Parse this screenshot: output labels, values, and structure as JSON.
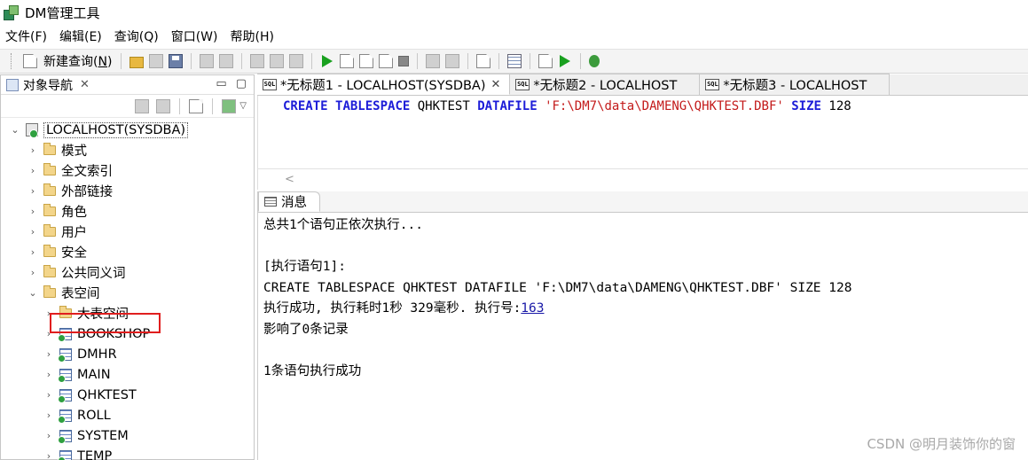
{
  "window": {
    "title": "DM管理工具"
  },
  "menu": [
    "文件(F)",
    "编辑(E)",
    "查询(Q)",
    "窗口(W)",
    "帮助(H)"
  ],
  "toolbar": {
    "new_query_prefix": "新建查询(",
    "new_query_key": "N",
    "new_query_suffix": ")"
  },
  "navigator": {
    "tab_label": "对象导航",
    "close": "✕",
    "minimize": "▭",
    "maximize": "▢",
    "root": "LOCALHOST(SYSDBA)",
    "items": [
      "模式",
      "全文索引",
      "外部链接",
      "角色",
      "用户",
      "安全",
      "公共同义词",
      "表空间"
    ],
    "tablespace_children": [
      "大表空间",
      "BOOKSHOP",
      "DMHR",
      "MAIN",
      "QHKTEST",
      "ROLL",
      "SYSTEM",
      "TEMP"
    ]
  },
  "editor_tabs": [
    {
      "label": "*无标题1 - LOCALHOST(SYSDBA)",
      "close": "✕",
      "active": true
    },
    {
      "label": "*无标题2 - LOCALHOST",
      "active": false
    },
    {
      "label": "*无标题3 - LOCALHOST",
      "active": false
    }
  ],
  "sql": {
    "kw1": "CREATE",
    "kw2": "TABLESPACE",
    "name": "QHKTEST",
    "kw3": "DATAFILE",
    "path": "'F:\\DM7\\data\\DAMENG\\QHKTEST.DBF'",
    "kw4": "SIZE",
    "size": "128"
  },
  "scroll_left_glyph": "<",
  "messages": {
    "tab_label": "消息",
    "line1": "总共1个语句正依次执行...",
    "line2": "",
    "line3": "[执行语句1]:",
    "line4": "CREATE TABLESPACE QHKTEST DATAFILE 'F:\\DM7\\data\\DAMENG\\QHKTEST.DBF' SIZE 128",
    "line5_prefix": "执行成功, 执行耗时1秒 329毫秒. 执行号:",
    "line5_link": "163",
    "line6": "影响了0条记录",
    "line7": "",
    "line8": "1条语句执行成功"
  },
  "watermark": "CSDN @明月装饰你的窗",
  "colors": {
    "keyword": "#1c1cd8",
    "string": "#c31a1a",
    "highlight_box": "#e01e1e"
  }
}
